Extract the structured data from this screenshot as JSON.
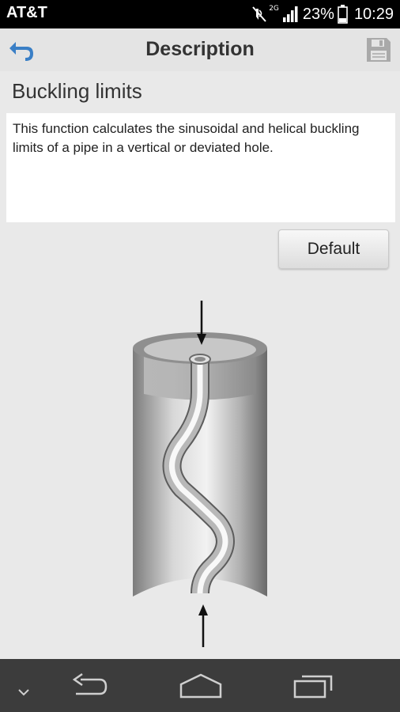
{
  "status_bar": {
    "carrier": "AT&T",
    "network_type": "2G",
    "battery_percent": "23%",
    "time": "10:29",
    "icons": [
      "mute-icon",
      "signal-icon",
      "battery-icon"
    ]
  },
  "action_bar": {
    "title": "Description",
    "back_icon": "back-arrow-icon",
    "save_icon": "save-icon"
  },
  "content": {
    "section_title": "Buckling limits",
    "description": "This function calculates the sinusoidal and helical buckling limits of a pipe in a vertical or deviated hole.",
    "default_button_label": "Default"
  },
  "illustration": {
    "subject": "buckled pipe inside casing",
    "icons": [
      "arrow-down-icon",
      "arrow-up-icon"
    ]
  },
  "nav_bar": {
    "icons": [
      "collapse-icon",
      "back-icon",
      "home-icon",
      "recent-apps-icon"
    ]
  },
  "colors": {
    "accent": "#3a7fc6",
    "action_bar": "#e4e4e4",
    "background": "#e9e9e9",
    "nav_bar": "#3c3c3c"
  }
}
